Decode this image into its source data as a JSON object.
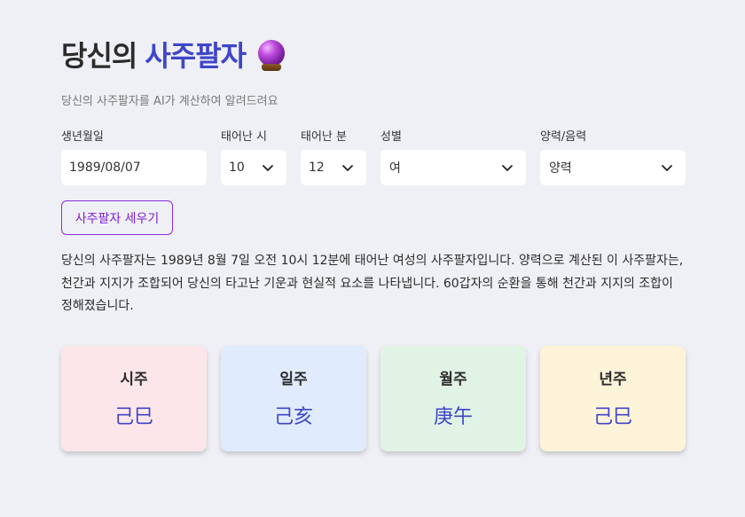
{
  "header": {
    "title_prefix": "당신의",
    "title_highlight": "사주팔자",
    "title_icon": "crystal-ball-icon",
    "subtitle": "당신의 사주팔자를 AI가 계산하여 알려드려요"
  },
  "form": {
    "birthdate": {
      "label": "생년월일",
      "value": "1989/08/07"
    },
    "hour": {
      "label": "태어난 시",
      "value": "10"
    },
    "minute": {
      "label": "태어난 분",
      "value": "12"
    },
    "gender": {
      "label": "성별",
      "value": "여"
    },
    "calendar": {
      "label": "양력/음력",
      "value": "양력"
    },
    "submit_label": "사주팔자 세우기"
  },
  "result": {
    "description": "당신의 사주팔자는 1989년 8월 7일 오전 10시 12분에 태어난 여성의 사주팔자입니다. 양력으로 계산된 이 사주팔자는, 천간과 지지가 조합되어 당신의 타고난 기운과 현실적 요소를 나타냅니다. 60갑자의 순환을 통해 천간과 지지의 조합이 정해졌습니다."
  },
  "pillars": [
    {
      "label": "시주",
      "value": "己巳",
      "color": "#fde6ea"
    },
    {
      "label": "일주",
      "value": "己亥",
      "color": "#e0ecfd"
    },
    {
      "label": "월주",
      "value": "庚午",
      "color": "#e1f3e5"
    },
    {
      "label": "년주",
      "value": "己巳",
      "color": "#fdf3d9"
    }
  ],
  "colors": {
    "accent": "#3f46c8",
    "button": "#7b1fd6",
    "background": "#eff0f5"
  }
}
